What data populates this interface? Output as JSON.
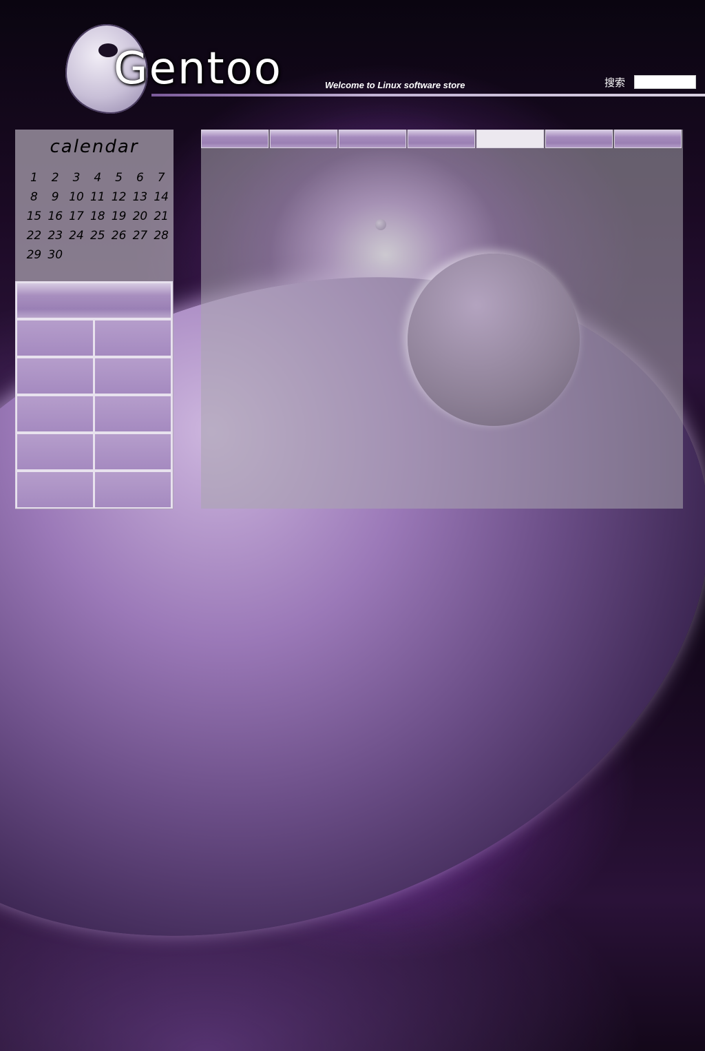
{
  "header": {
    "logo_text": "Gentoo",
    "tagline": "Welcome to Linux software store",
    "search_label": "搜索",
    "search_value": ""
  },
  "calendar": {
    "title": "calendar",
    "days": [
      "1",
      "2",
      "3",
      "4",
      "5",
      "6",
      "7",
      "8",
      "9",
      "10",
      "11",
      "12",
      "13",
      "14",
      "15",
      "16",
      "17",
      "18",
      "19",
      "20",
      "21",
      "22",
      "23",
      "24",
      "25",
      "26",
      "27",
      "28",
      "29",
      "30"
    ]
  },
  "tabs": {
    "count": 7,
    "active_index": 4
  },
  "sidebar_menu": {
    "rows": 5,
    "cols": 2
  },
  "colors": {
    "accent_purple": "#9b80b4",
    "active_tab": "#ece8ef"
  }
}
